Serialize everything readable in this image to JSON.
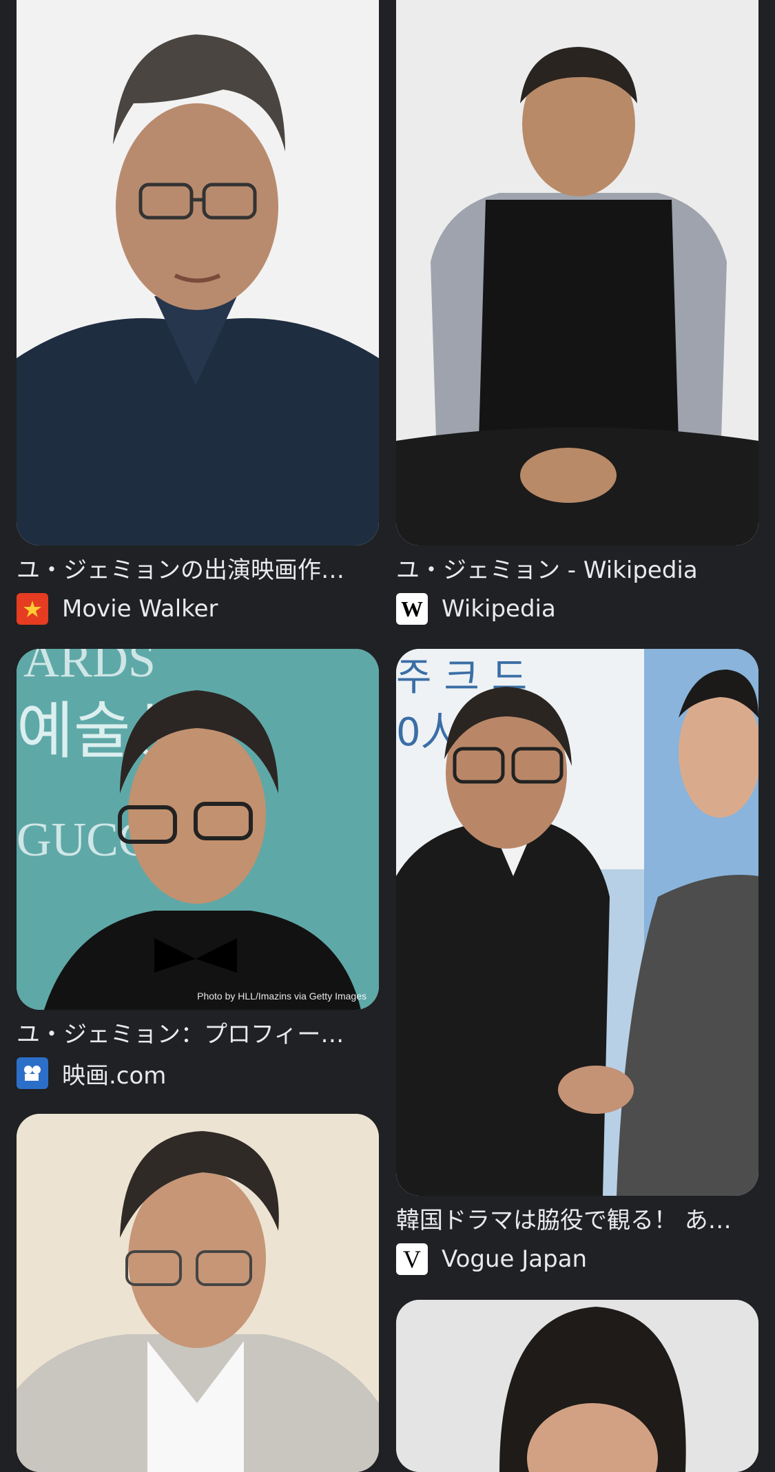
{
  "results": [
    {
      "title": "ユ・ジェミョンの出演映画作…",
      "source": "Movie Walker",
      "icon": "movie-walker-logo",
      "icon_color": "#e53c22"
    },
    {
      "title": "ユ・ジェミョン - Wikipedia",
      "source": "Wikipedia",
      "icon": "wikipedia-logo",
      "icon_color": "#ffffff"
    },
    {
      "title": "ユ・ジェミョン：プロフィー…",
      "source": "映画.com",
      "icon": "eiga-com-logo",
      "icon_color": "#2c6fc9",
      "credit": "Photo by HLL/Imazins via Getty Images"
    },
    {
      "title": "韓国ドラマは脇役で観る！ あ…",
      "source": "Vogue Japan",
      "icon": "vogue-logo",
      "icon_color": "#ffffff"
    },
    {
      "title": "",
      "source": "",
      "icon": "",
      "icon_color": ""
    },
    {
      "title": "",
      "source": "",
      "icon": "",
      "icon_color": ""
    }
  ],
  "background_text": {
    "award_backdrop": "ARDS",
    "award_korean": "예술상",
    "award_brand": "GUCCI",
    "event_backdrop_line1": "주 크 드",
    "event_backdrop_line2": "0人"
  }
}
